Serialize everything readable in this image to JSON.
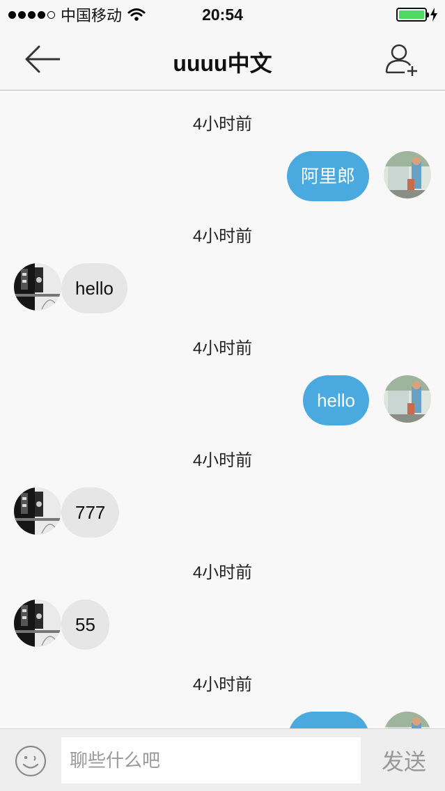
{
  "status_bar": {
    "carrier": "中国移动",
    "time": "20:54",
    "signal_bars_filled": 4,
    "signal_bars_total": 5,
    "battery_level": 1.0,
    "battery_color": "#4cd964"
  },
  "nav": {
    "title": "uuuu中文",
    "back_icon": "arrow-left-icon",
    "add_icon": "add-contact-icon"
  },
  "messages": [
    {
      "time": "4小时前",
      "direction": "outgoing",
      "text": "阿里郎",
      "avatar": "other-avatar"
    },
    {
      "time": "4小时前",
      "direction": "incoming",
      "text": "hello",
      "avatar": "self-avatar"
    },
    {
      "time": "4小时前",
      "direction": "outgoing",
      "text": "hello",
      "avatar": "other-avatar"
    },
    {
      "time": "4小时前",
      "direction": "incoming",
      "text": "777",
      "avatar": "self-avatar"
    },
    {
      "time": "4小时前",
      "direction": "incoming",
      "text": "55",
      "avatar": "self-avatar"
    },
    {
      "time": "4小时前",
      "direction": "outgoing",
      "text": "",
      "avatar": "other-avatar"
    }
  ],
  "input_bar": {
    "placeholder": "聊些什么吧",
    "value": "",
    "send_label": "发送",
    "emoji_icon": "smiley-icon"
  },
  "colors": {
    "outgoing_bubble": "#4aa9df",
    "incoming_bubble": "#e6e6e6",
    "background": "#f8f8f8"
  }
}
